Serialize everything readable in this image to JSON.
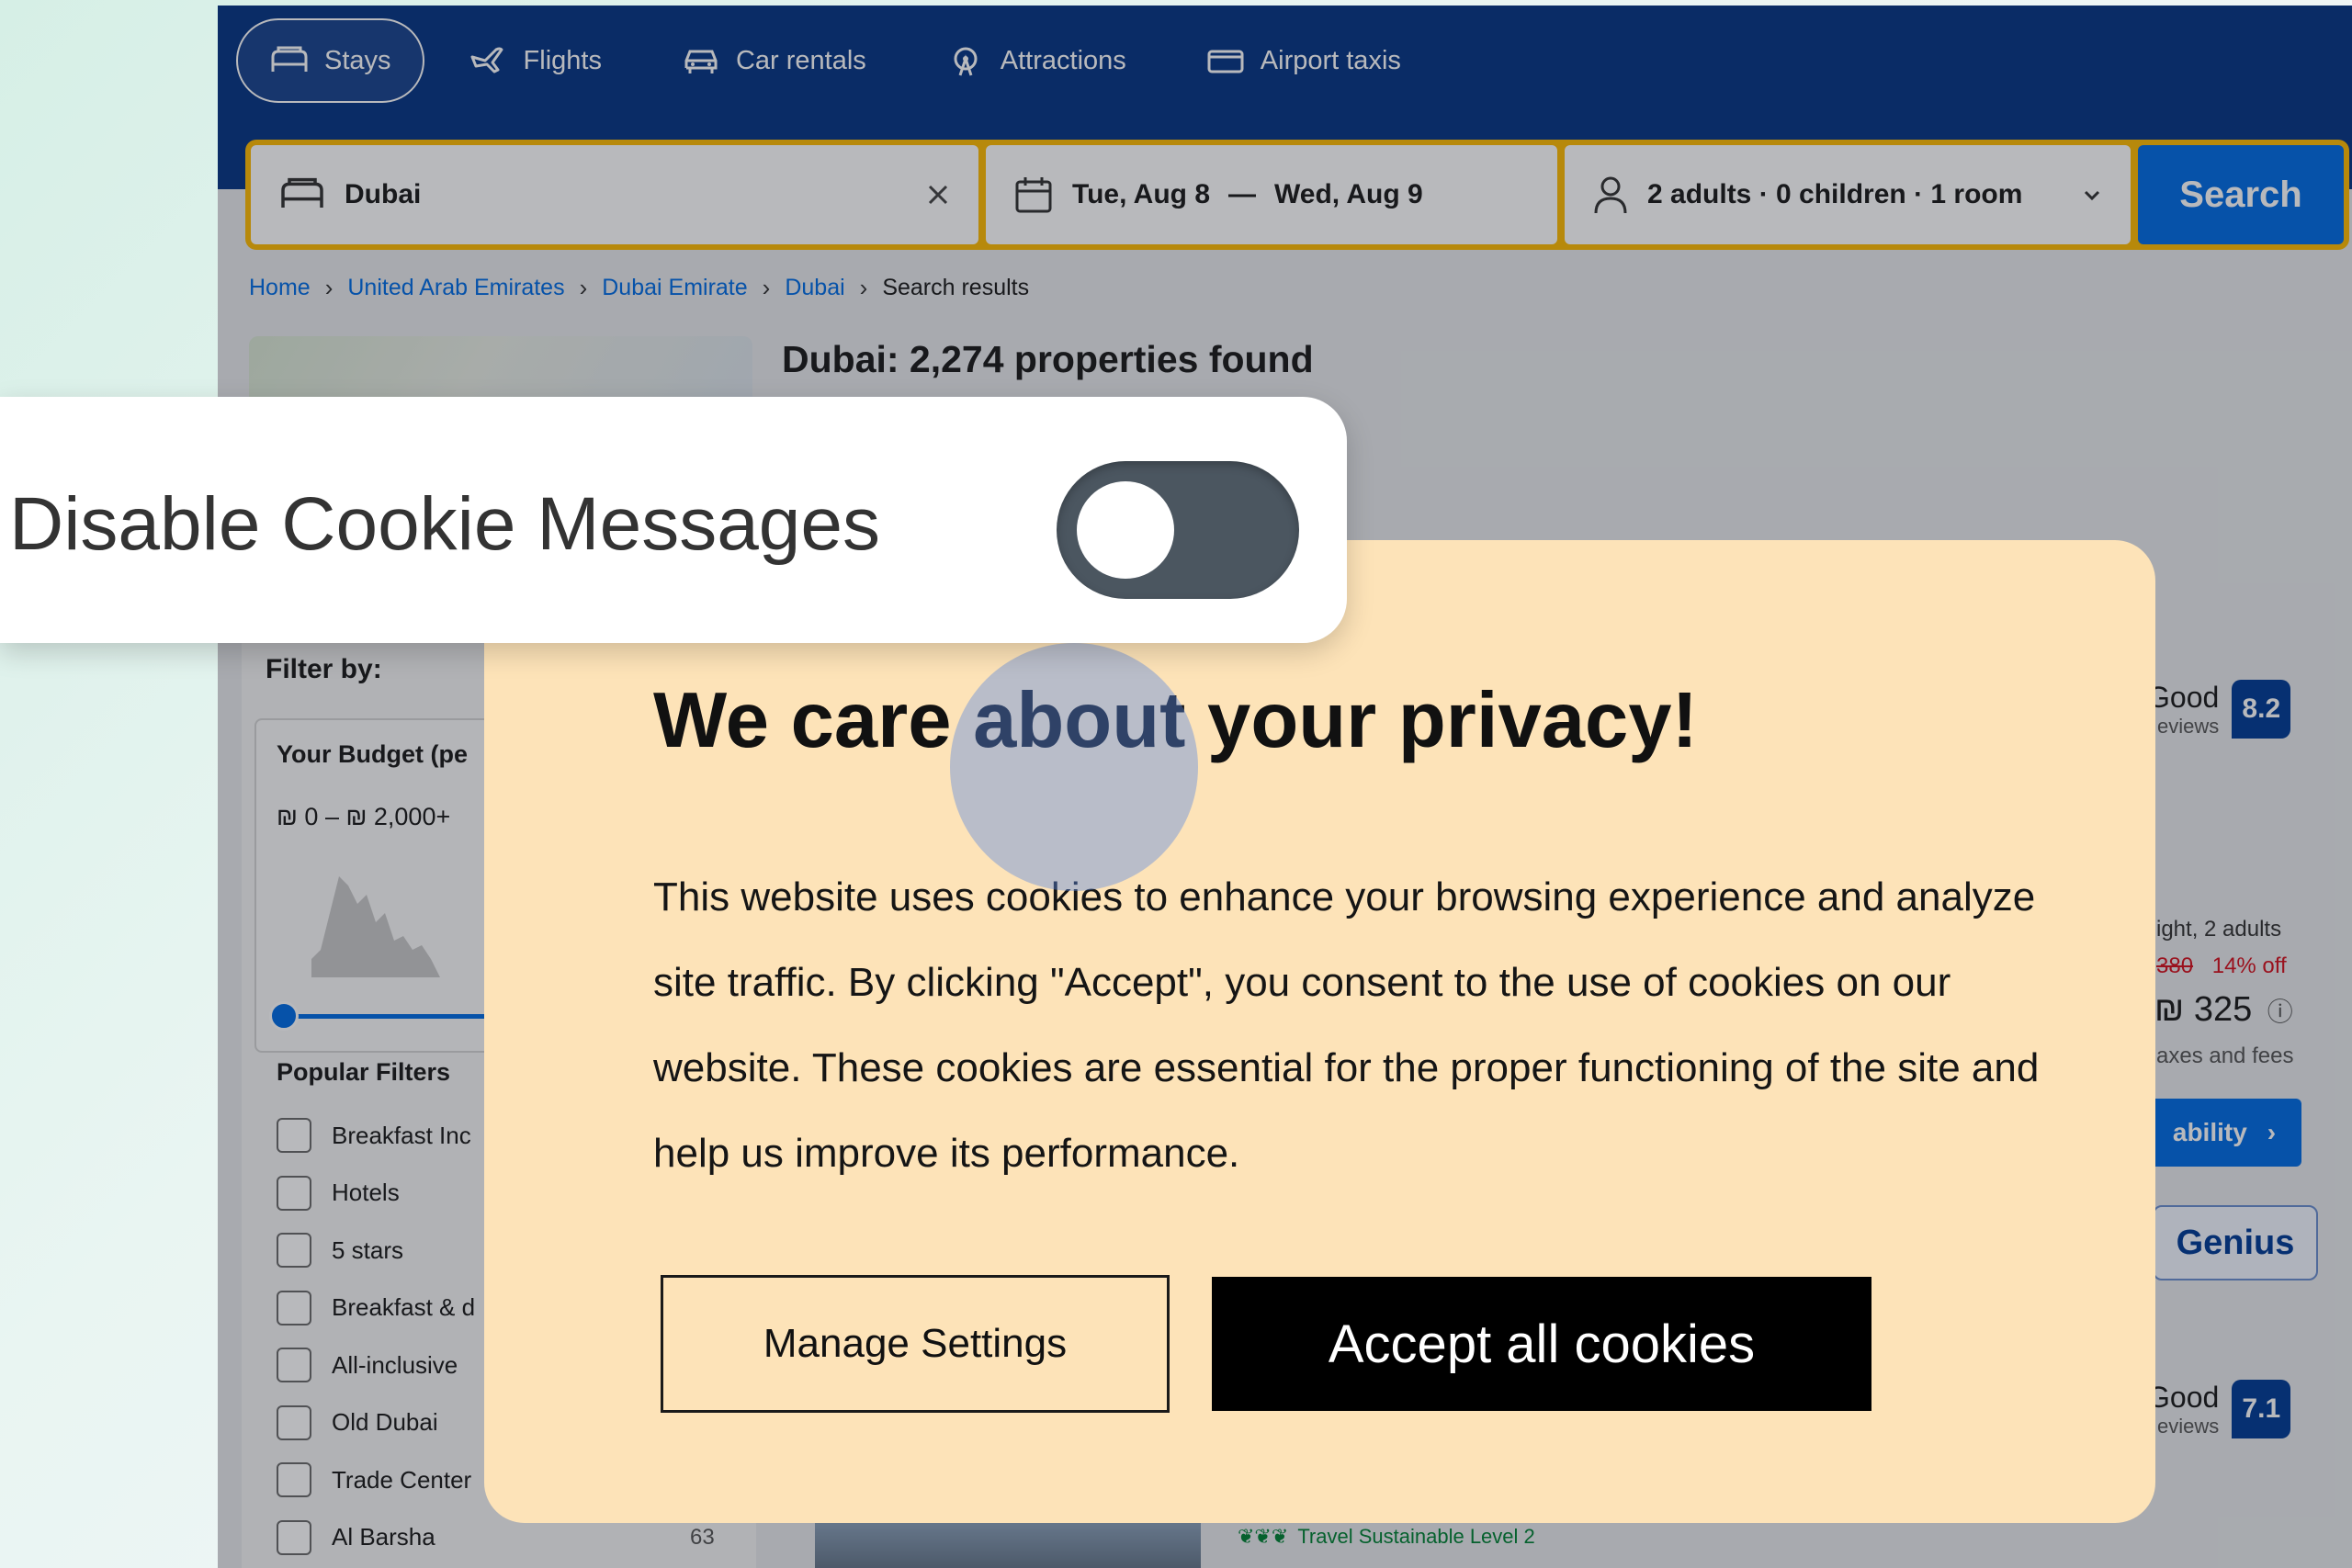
{
  "nav": {
    "items": [
      {
        "label": "Stays",
        "icon": "bed-icon"
      },
      {
        "label": "Flights",
        "icon": "plane-icon"
      },
      {
        "label": "Car rentals",
        "icon": "car-icon"
      },
      {
        "label": "Attractions",
        "icon": "attractions-icon"
      },
      {
        "label": "Airport taxis",
        "icon": "taxi-icon"
      }
    ],
    "active": "Stays"
  },
  "search": {
    "destination": "Dubai",
    "dates_from": "Tue, Aug 8",
    "dates_sep": "—",
    "dates_to": "Wed, Aug 9",
    "guests": "2 adults · 0 children · 1 room",
    "button": "Search"
  },
  "breadcrumb": [
    "Home",
    "United Arab Emirates",
    "Dubai Emirate",
    "Dubai",
    "Search results"
  ],
  "results": {
    "title": "Dubai: 2,274 properties found"
  },
  "filters": {
    "title": "Filter by:",
    "budget_title": "Your Budget (pe",
    "budget_range": "₪ 0 – ₪ 2,000+",
    "popular_title": "Popular Filters",
    "popular": [
      {
        "label": "Breakfast Inc",
        "count": ""
      },
      {
        "label": "Hotels",
        "count": ""
      },
      {
        "label": "5 stars",
        "count": ""
      },
      {
        "label": "Breakfast & d",
        "count": ""
      },
      {
        "label": "All-inclusive",
        "count": ""
      },
      {
        "label": "Old Dubai",
        "count": ""
      },
      {
        "label": "Trade Center",
        "count": ""
      },
      {
        "label": "Al Barsha",
        "count": "63"
      }
    ]
  },
  "cards": [
    {
      "rating_word": "Good",
      "reviews": "eviews",
      "score": "8.2",
      "stay": "ight, 2 adults",
      "old_price": "380",
      "discount": "14% off",
      "price": "₪ 325",
      "taxes": "axes and fees",
      "availability": "ability",
      "genius": "Genius"
    },
    {
      "rating_word": "Good",
      "reviews": "eviews",
      "score": "7.1",
      "sustainable": "Travel Sustainable Level 2"
    }
  ],
  "consent": {
    "title": "We care about your privacy!",
    "body": "This website uses cookies to enhance your browsing experience and analyze site traffic. By clicking \"Accept\", you consent to the use of cookies on our website. These cookies are essential for the proper functioning of the site and help us improve its performance.",
    "manage": "Manage Settings",
    "accept": "Accept all cookies",
    "close": "×"
  },
  "toggle": {
    "label": "Disable Cookie Messages",
    "state": false
  }
}
